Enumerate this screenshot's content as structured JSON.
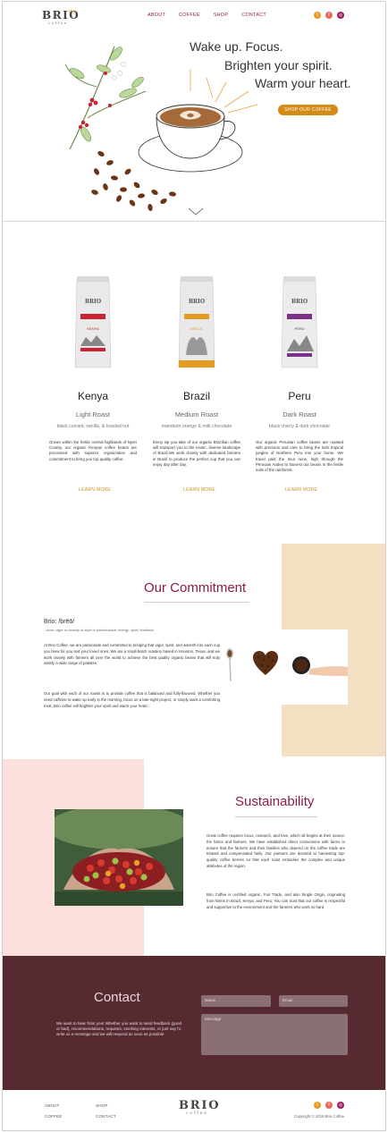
{
  "brand": {
    "name": "BRIO",
    "tagline": "coffee"
  },
  "nav": {
    "items": [
      "ABOUT",
      "COFFEE",
      "SHOP",
      "CONTACT"
    ]
  },
  "social": {
    "twitter": "twitter-icon",
    "facebook": "facebook-icon",
    "instagram": "instagram-icon",
    "colors": {
      "twitter": "#e89a23",
      "facebook": "#e36d5d",
      "instagram": "#9c1d5b"
    }
  },
  "hero": {
    "line1": "Wake up. Focus.",
    "line2": "Brighten your spirit.",
    "line3": "Warm your heart.",
    "cta": "SHOP OUR COFFEE"
  },
  "products": [
    {
      "name": "Kenya",
      "roast": "Light Roast",
      "notes": "black currant, vanilla, & toasted nut",
      "bag_label": "KENYA",
      "bag_color": "#c8242f",
      "description": "Grown within the fertile central highlands of Nyeri County, our organic Kenyan coffee beans are processed with superior organization and commitment to bring you top quality coffee.",
      "link": "LEARN MORE"
    },
    {
      "name": "Brazil",
      "roast": "Medium Roast",
      "notes": "mandarin orange & milk chocolate",
      "bag_label": "BRAZIL",
      "bag_color": "#e59a22",
      "description": "Every sip you take of our organic Brazilian coffee will transport you to the exotic, diverse landscape of Brazil.We work closely with dedicated farmers in Brazil to produce the perfect cup that you can enjoy day after day.",
      "link": "LEARN MORE"
    },
    {
      "name": "Peru",
      "roast": "Dark Roast",
      "notes": "black cherry & dark chocolate",
      "bag_label": "PERU",
      "bag_color": "#7d2f8c",
      "description": "Our organic Peruvian coffee beans are roasted with precision and care to bring the lush tropical jungles of Northern Peru into your home. We travel past the Inca ruins, high through the Peruvian Andes to harvest our beans in the fertile soils of the rainforest.",
      "link": "LEARN MORE"
    }
  ],
  "commitment": {
    "title": "Our Commitment",
    "definition": "Brio: /brēō/",
    "definition_sub": "- noun: vigor or vivacity of style or performance; energy; spirit; liveliness",
    "para1": "At Brio Coffee, we are passionate and committed to bringing that vigor, spirit, and warmth into each cup you brew for you and your loved ones. We are a small-batch roastery based in Houston, Texas, and we work closely with farmers all over the world to achieve the best quality organic beans that will truly satisfy a wide range of palettes.",
    "para2": "Our goal with each of our roasts is to provide coffee that is balanced and fully-flavored. Whether you need caffeine to wake up early in the morning, focus on a late-night project, or simply want a comforting treat, Brio coffee will brighten your spirit and warm your heart."
  },
  "sustainability": {
    "title": "Sustainability",
    "para1": "Great coffee requires focus, research, and love, which all begins at their source: the farms and farmers. We have established direct connections with farms to ensure that the farmers and their families who depend on the coffee trade are treated and compensated fairly. Our partners are devoted to harvesting top-quality coffee berries so that each roast embodies the complex and unique attributes of the region.",
    "para2": "Brio Coffee is certified organic, Fair Trade, and also Single Origin, originating from farms in Brazil, Kenya, and Peru. You can trust that our coffee is respectful and supportive to the environment and the farmers who work so hard."
  },
  "contact": {
    "title": "Contact",
    "text": "We want to hear from you! Whether you want to send feedback (good or bad), recommendations, requests, stocking interests, or just say hi, write us a message and we will respond as soon as possible.",
    "name_placeholder": "Name",
    "email_placeholder": "Email",
    "message_placeholder": "Message"
  },
  "footer": {
    "links": [
      "ABOUT",
      "SHOP",
      "COFFEE",
      "CONTACT"
    ],
    "copyright": "Copyright © 2018 Brio Coffee"
  }
}
